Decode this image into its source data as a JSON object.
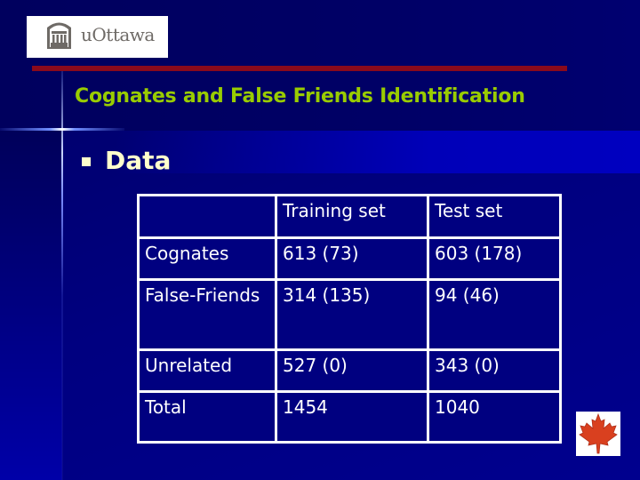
{
  "logo": {
    "text": "uOttawa",
    "icon": "university-building-icon"
  },
  "slide": {
    "title": "Cognates and False Friends Identification",
    "bullet": "Data"
  },
  "table": {
    "headers": [
      "",
      "Training set",
      "Test set"
    ],
    "rows": [
      [
        "Cognates",
        "613 (73)",
        "603 (178)"
      ],
      [
        "False-Friends",
        "314 (135)",
        "94 (46)"
      ],
      [
        "Unrelated",
        "527 (0)",
        "343 (0)"
      ],
      [
        "Total",
        "1454",
        "1040"
      ]
    ]
  },
  "footer_logo": {
    "icon": "maple-leaf-icon"
  },
  "colors": {
    "title": "#99cc00",
    "bullet_text": "#ffffcc",
    "rule": "#8a0a1c",
    "background": "#000080"
  }
}
